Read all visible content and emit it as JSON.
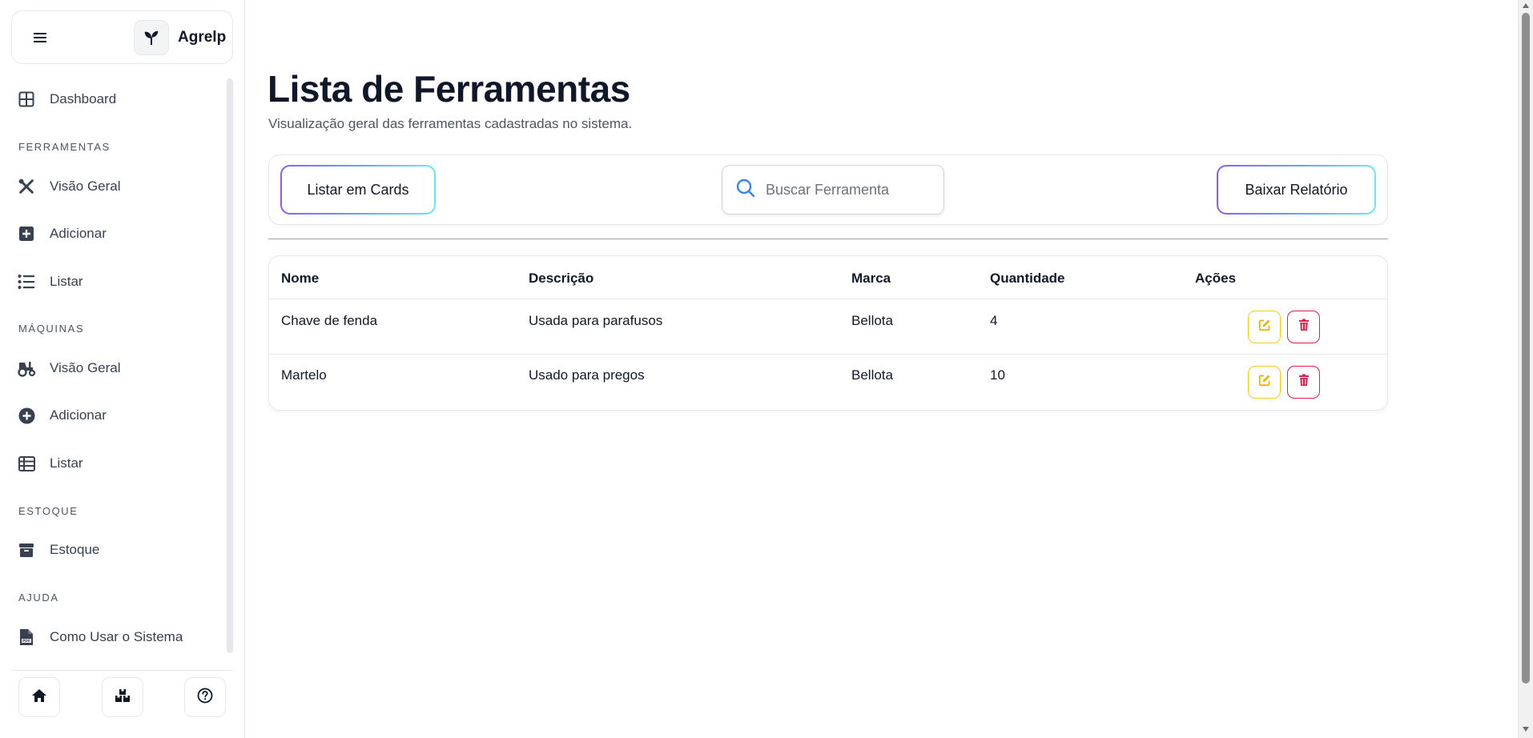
{
  "brand": {
    "name": "Agrelp"
  },
  "sidebar": {
    "dashboard": "Dashboard",
    "sections": [
      {
        "title": "FERRAMENTAS",
        "items": [
          "Visão Geral",
          "Adicionar",
          "Listar"
        ]
      },
      {
        "title": "MÁQUINAS",
        "items": [
          "Visão Geral",
          "Adicionar",
          "Listar"
        ]
      },
      {
        "title": "ESTOQUE",
        "items": [
          "Estoque"
        ]
      },
      {
        "title": "AJUDA",
        "items": [
          "Como Usar o Sistema"
        ]
      }
    ]
  },
  "main": {
    "title": "Lista de Ferramentas",
    "subtitle": "Visualização geral das ferramentas cadastradas no sistema.",
    "toolbar": {
      "list_cards": "Listar em Cards",
      "search_placeholder": "Buscar Ferramenta",
      "download": "Baixar Relatório"
    },
    "table": {
      "headers": [
        "Nome",
        "Descrição",
        "Marca",
        "Quantidade",
        "Ações"
      ],
      "rows": [
        [
          "Chave de fenda",
          "Usada para parafusos",
          "Bellota",
          "4"
        ],
        [
          "Martelo",
          "Usado para pregos",
          "Bellota",
          "10"
        ]
      ]
    }
  },
  "colors": {
    "edit": "#facc15",
    "delete": "#e11d48",
    "title": "#0f172a"
  }
}
